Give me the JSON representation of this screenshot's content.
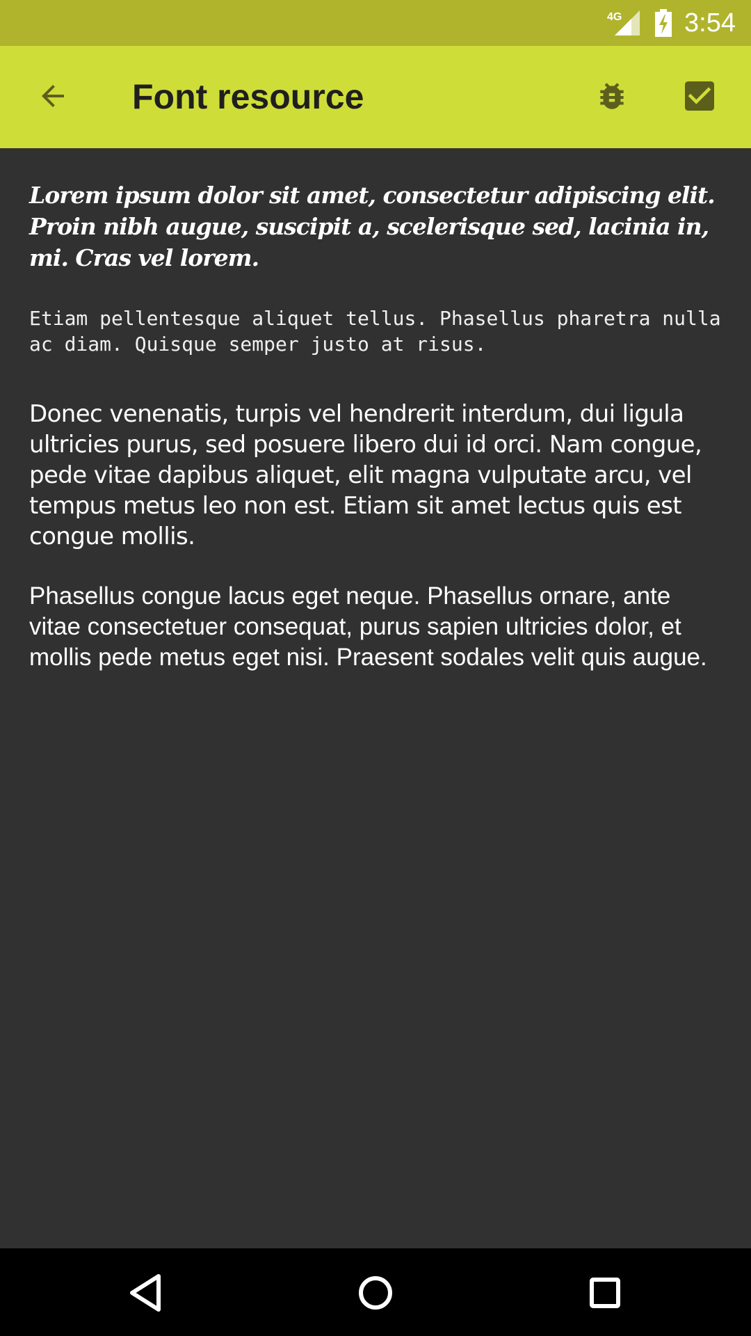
{
  "status_bar": {
    "network_label": "4G",
    "time": "3:54",
    "icons": [
      "signal-4g-icon",
      "battery-charging-icon"
    ]
  },
  "toolbar": {
    "title": "Font resource",
    "icons": [
      "back-arrow-icon",
      "bug-icon",
      "checkbox-checked-icon"
    ]
  },
  "content": {
    "paragraphs": [
      "Lorem ipsum dolor sit amet, consectetur adipiscing elit. Proin nibh augue, suscipit a, scelerisque sed, lacinia in, mi. Cras vel lorem.",
      "Etiam pellentesque aliquet tellus. Phasellus pharetra nulla ac diam. Quisque semper justo at risus.",
      "Donec venenatis, turpis vel hendrerit interdum, dui ligula ultricies purus, sed posuere libero dui id orci. Nam congue, pede vitae dapibus aliquet, elit magna vulputate arcu, vel tempus metus leo non est. Etiam sit amet lectus quis est congue mollis.",
      "Phasellus congue lacus eget neque. Phasellus ornare, ante vitae consectetuer consequat, purus sapien ultricies dolor, et mollis pede metus eget nisi. Praesent sodales velit quis augue."
    ]
  },
  "nav_bar": {
    "icons": [
      "nav-back-icon",
      "nav-home-icon",
      "nav-recents-icon"
    ]
  },
  "colors": {
    "status_bar": "#b0b42d",
    "toolbar": "#cfdd38",
    "toolbar_icon": "#5c5f1c",
    "background": "#313131",
    "text": "#ffffff",
    "nav_bar": "#000000"
  }
}
